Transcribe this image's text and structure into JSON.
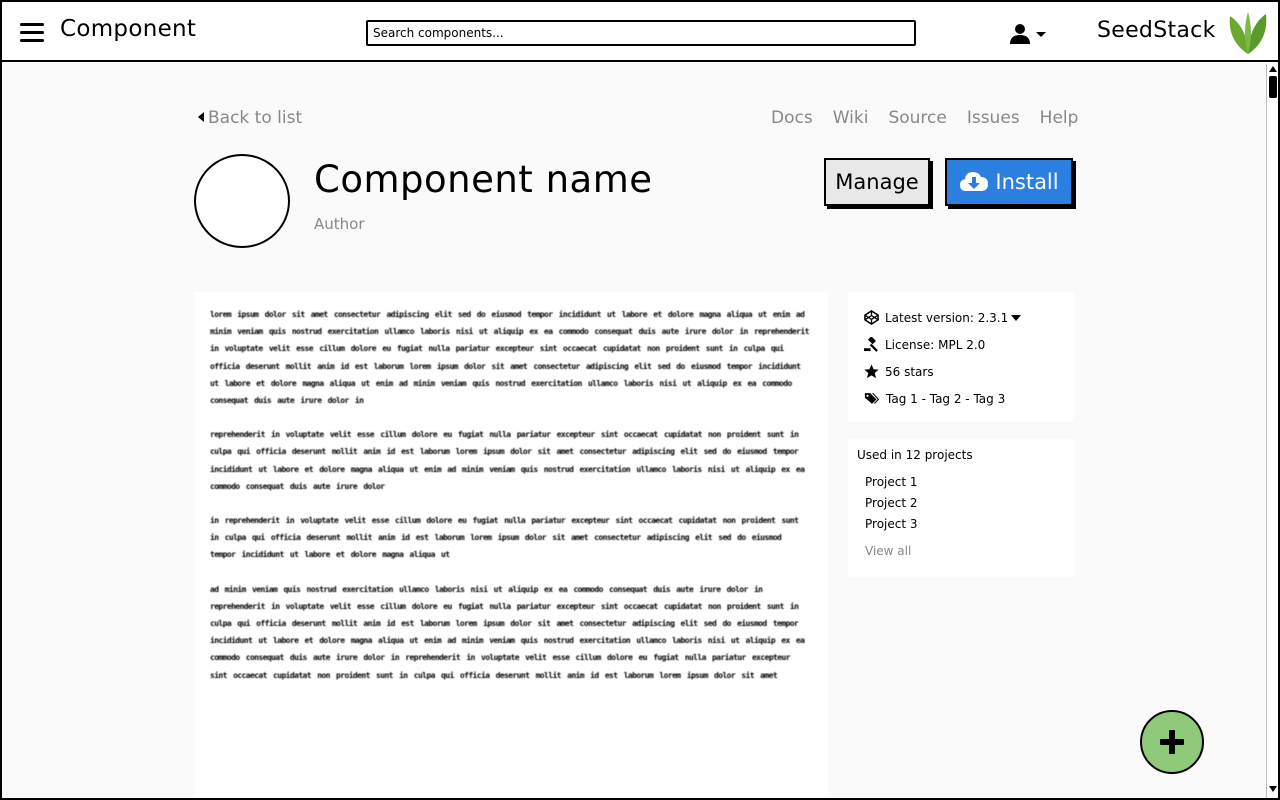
{
  "header": {
    "title": "Component",
    "search_placeholder": "Search components...",
    "brand": "SeedStack"
  },
  "nav": {
    "back_label": "Back to list",
    "links": [
      "Docs",
      "Wiki",
      "Source",
      "Issues",
      "Help"
    ]
  },
  "component": {
    "name": "Component name",
    "author": "Author",
    "manage_label": "Manage",
    "install_label": "Install"
  },
  "description": {
    "paragraphs": [
      "lorem ipsum dolor sit amet consectetur adipiscing elit sed do eiusmod tempor incididunt ut labore et dolore magna aliqua ut enim ad minim veniam quis nostrud exercitation ullamco laboris nisi ut aliquip ex ea commodo consequat duis aute irure dolor in reprehenderit in voluptate velit esse cillum dolore eu fugiat nulla pariatur excepteur sint occaecat cupidatat non proident sunt in culpa qui officia deserunt mollit anim id est laborum lorem ipsum dolor sit amet consectetur adipiscing elit sed do eiusmod tempor incididunt ut labore et dolore magna aliqua ut enim ad minim veniam quis nostrud exercitation ullamco laboris nisi ut aliquip ex ea commodo consequat duis aute irure dolor in",
      "reprehenderit in voluptate velit esse cillum dolore eu fugiat nulla pariatur excepteur sint occaecat cupidatat non proident sunt in culpa qui officia deserunt mollit anim id est laborum lorem ipsum dolor sit amet consectetur adipiscing elit sed do eiusmod tempor incididunt ut labore et dolore magna aliqua ut enim ad minim veniam quis nostrud exercitation ullamco laboris nisi ut aliquip ex ea commodo consequat duis aute irure dolor",
      "in reprehenderit in voluptate velit esse cillum dolore eu fugiat nulla pariatur excepteur sint occaecat cupidatat non proident sunt in culpa qui officia deserunt mollit anim id est laborum lorem ipsum dolor sit amet consectetur adipiscing elit sed do eiusmod tempor incididunt ut labore et dolore magna aliqua ut",
      "ad minim veniam quis nostrud exercitation ullamco laboris nisi ut aliquip ex ea commodo consequat duis aute irure dolor in reprehenderit in voluptate velit esse cillum dolore eu fugiat nulla pariatur excepteur sint occaecat cupidatat non proident sunt in culpa qui officia deserunt mollit anim id est laborum lorem ipsum dolor sit amet consectetur adipiscing elit sed do eiusmod tempor incididunt ut labore et dolore magna aliqua ut enim ad minim veniam quis nostrud exercitation ullamco laboris nisi ut aliquip ex ea commodo consequat duis aute irure dolor in reprehenderit in voluptate velit esse cillum dolore eu fugiat nulla pariatur excepteur sint occaecat cupidatat non proident sunt in culpa qui officia deserunt mollit anim id est laborum lorem ipsum dolor sit amet"
    ]
  },
  "info": {
    "version": "Latest version: 2.3.1",
    "license": "License: MPL 2.0",
    "stars": "56 stars",
    "tags": "Tag 1 - Tag 2 - Tag 3"
  },
  "projects": {
    "title": "Used in 12 projects",
    "items": [
      "Project 1",
      "Project 2",
      "Project 3"
    ],
    "view_all": "View all"
  },
  "colors": {
    "install_blue": "#2a7fe0",
    "fab_green": "#8fc97a",
    "muted_text": "#888888",
    "logo_green": "#6aa832"
  },
  "icons": {
    "menu": "hamburger-icon",
    "user": "user-icon",
    "version": "codepen-icon",
    "license": "gavel-icon",
    "stars": "star-icon",
    "tags": "tags-icon",
    "install": "cloud-download-icon",
    "fab": "plus-icon"
  }
}
